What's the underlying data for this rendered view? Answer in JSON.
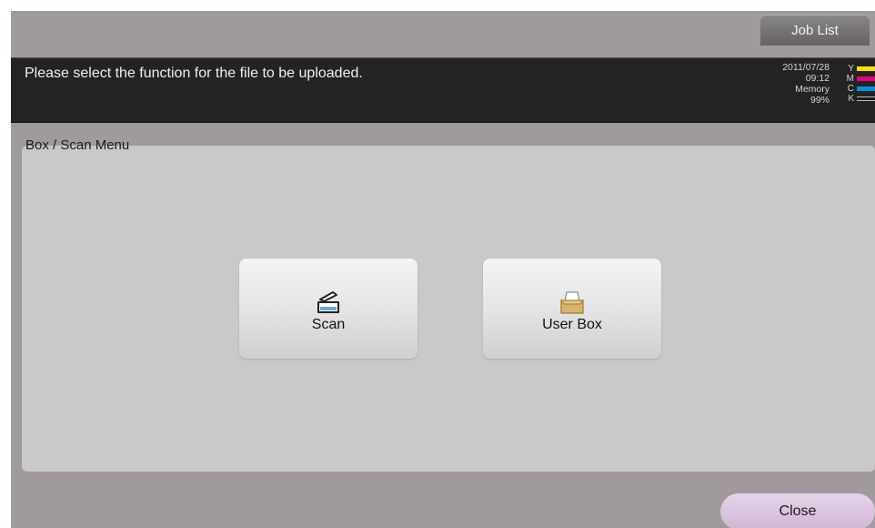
{
  "header": {
    "job_list_label": "Job List"
  },
  "message_bar": {
    "message": "Please select the function for the file to be uploaded.",
    "date": "2011/07/28",
    "time": "09:12",
    "memory_label": "Memory",
    "memory_value": "99%",
    "toner": [
      {
        "label": "Y",
        "color": "#f5e400"
      },
      {
        "label": "M",
        "color": "#e8007c"
      },
      {
        "label": "C",
        "color": "#0096d8"
      },
      {
        "label": "K",
        "color": "#1a1a1a"
      }
    ]
  },
  "panel": {
    "title": "Box / Scan Menu",
    "buttons": [
      {
        "label": "Scan",
        "icon": "scanner-icon"
      },
      {
        "label": "User Box",
        "icon": "user-box-icon"
      }
    ]
  },
  "footer": {
    "close_label": "Close"
  }
}
